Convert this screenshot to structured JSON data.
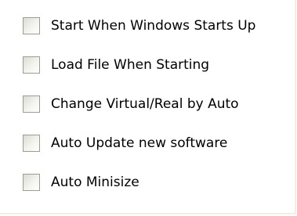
{
  "options": [
    {
      "label": "Start When Windows Starts Up",
      "checked": false
    },
    {
      "label": "Load File When Starting",
      "checked": false
    },
    {
      "label": "Change Virtual/Real by Auto",
      "checked": false
    },
    {
      "label": "Auto Update new software",
      "checked": false
    },
    {
      "label": "Auto Minisize",
      "checked": false
    }
  ]
}
